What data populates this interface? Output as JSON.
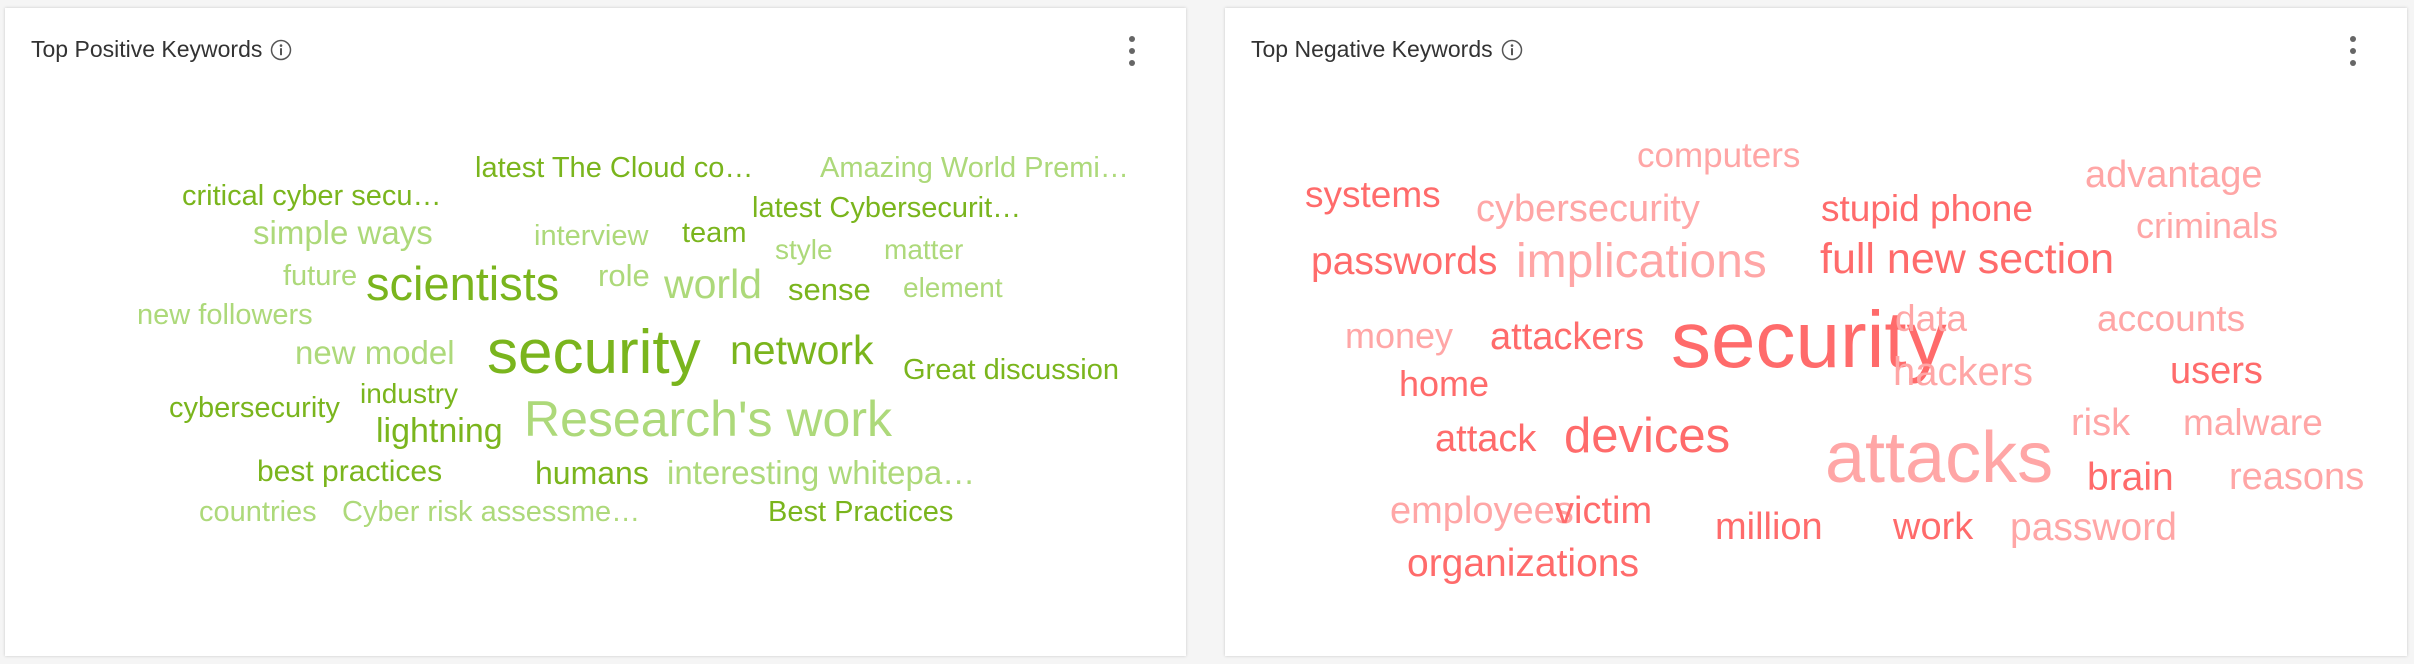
{
  "colors": {
    "positive_dark": "#7ab51d",
    "positive_light": "#add97a",
    "negative_dark": "#ff6b6b",
    "negative_light": "#ffa6a6",
    "title_text": "#333333",
    "background": "#f5f5f5",
    "panel": "#ffffff"
  },
  "panels": {
    "positive": {
      "title": "Top Positive Keywords",
      "info_icon": "info-circle-icon",
      "menu_icon": "more-vertical-icon",
      "words": [
        {
          "text": "latest The Cloud co…",
          "tone": "dark",
          "weight": 3
        },
        {
          "text": "Amazing World Premi…",
          "tone": "light",
          "weight": 3
        },
        {
          "text": "critical cyber secu…",
          "tone": "dark",
          "weight": 3
        },
        {
          "text": "latest Cybersecurit…",
          "tone": "dark",
          "weight": 3
        },
        {
          "text": "simple ways",
          "tone": "light",
          "weight": 4
        },
        {
          "text": "interview",
          "tone": "light",
          "weight": 3
        },
        {
          "text": "team",
          "tone": "dark",
          "weight": 3
        },
        {
          "text": "style",
          "tone": "light",
          "weight": 3
        },
        {
          "text": "matter",
          "tone": "light",
          "weight": 3
        },
        {
          "text": "future",
          "tone": "light",
          "weight": 3
        },
        {
          "text": "scientists",
          "tone": "dark",
          "weight": 7
        },
        {
          "text": "role",
          "tone": "light",
          "weight": 3
        },
        {
          "text": "world",
          "tone": "light",
          "weight": 5
        },
        {
          "text": "sense",
          "tone": "dark",
          "weight": 3
        },
        {
          "text": "element",
          "tone": "light",
          "weight": 3
        },
        {
          "text": "new followers",
          "tone": "light",
          "weight": 3
        },
        {
          "text": "new model",
          "tone": "light",
          "weight": 4
        },
        {
          "text": "security",
          "tone": "dark",
          "weight": 10
        },
        {
          "text": "network",
          "tone": "dark",
          "weight": 5
        },
        {
          "text": "Great discussion",
          "tone": "dark",
          "weight": 3
        },
        {
          "text": "cybersecurity",
          "tone": "dark",
          "weight": 3
        },
        {
          "text": "industry",
          "tone": "dark",
          "weight": 3
        },
        {
          "text": "lightning",
          "tone": "dark",
          "weight": 4
        },
        {
          "text": "Research's work",
          "tone": "light",
          "weight": 8
        },
        {
          "text": "best practices",
          "tone": "dark",
          "weight": 3
        },
        {
          "text": "humans",
          "tone": "dark",
          "weight": 3
        },
        {
          "text": "interesting whitepa…",
          "tone": "light",
          "weight": 4
        },
        {
          "text": "countries",
          "tone": "light",
          "weight": 3
        },
        {
          "text": "Cyber risk assessme…",
          "tone": "light",
          "weight": 3
        },
        {
          "text": "Best Practices",
          "tone": "dark",
          "weight": 3
        }
      ]
    },
    "negative": {
      "title": "Top Negative Keywords",
      "info_icon": "info-circle-icon",
      "menu_icon": "more-vertical-icon",
      "words": [
        {
          "text": "computers",
          "tone": "light",
          "weight": 4
        },
        {
          "text": "systems",
          "tone": "dark",
          "weight": 4
        },
        {
          "text": "cybersecurity",
          "tone": "light",
          "weight": 4
        },
        {
          "text": "stupid phone",
          "tone": "dark",
          "weight": 4
        },
        {
          "text": "advantage",
          "tone": "light",
          "weight": 4
        },
        {
          "text": "criminals",
          "tone": "light",
          "weight": 4
        },
        {
          "text": "passwords",
          "tone": "dark",
          "weight": 4
        },
        {
          "text": "implications",
          "tone": "light",
          "weight": 5
        },
        {
          "text": "full new section",
          "tone": "dark",
          "weight": 5
        },
        {
          "text": "money",
          "tone": "light",
          "weight": 4
        },
        {
          "text": "attackers",
          "tone": "dark",
          "weight": 4
        },
        {
          "text": "security",
          "tone": "dark",
          "weight": 10
        },
        {
          "text": "data",
          "tone": "light",
          "weight": 4
        },
        {
          "text": "accounts",
          "tone": "light",
          "weight": 4
        },
        {
          "text": "home",
          "tone": "dark",
          "weight": 4
        },
        {
          "text": "hackers",
          "tone": "light",
          "weight": 4
        },
        {
          "text": "users",
          "tone": "dark",
          "weight": 4
        },
        {
          "text": "attack",
          "tone": "dark",
          "weight": 4
        },
        {
          "text": "devices",
          "tone": "dark",
          "weight": 5
        },
        {
          "text": "attacks",
          "tone": "light",
          "weight": 9
        },
        {
          "text": "risk",
          "tone": "light",
          "weight": 4
        },
        {
          "text": "malware",
          "tone": "light",
          "weight": 4
        },
        {
          "text": "brain",
          "tone": "dark",
          "weight": 4
        },
        {
          "text": "reasons",
          "tone": "light",
          "weight": 4
        },
        {
          "text": "employees",
          "tone": "light",
          "weight": 4
        },
        {
          "text": "victim",
          "tone": "dark",
          "weight": 4
        },
        {
          "text": "million",
          "tone": "dark",
          "weight": 4
        },
        {
          "text": "work",
          "tone": "dark",
          "weight": 4
        },
        {
          "text": "password",
          "tone": "light",
          "weight": 4
        },
        {
          "text": "organizations",
          "tone": "dark",
          "weight": 4
        }
      ]
    }
  }
}
